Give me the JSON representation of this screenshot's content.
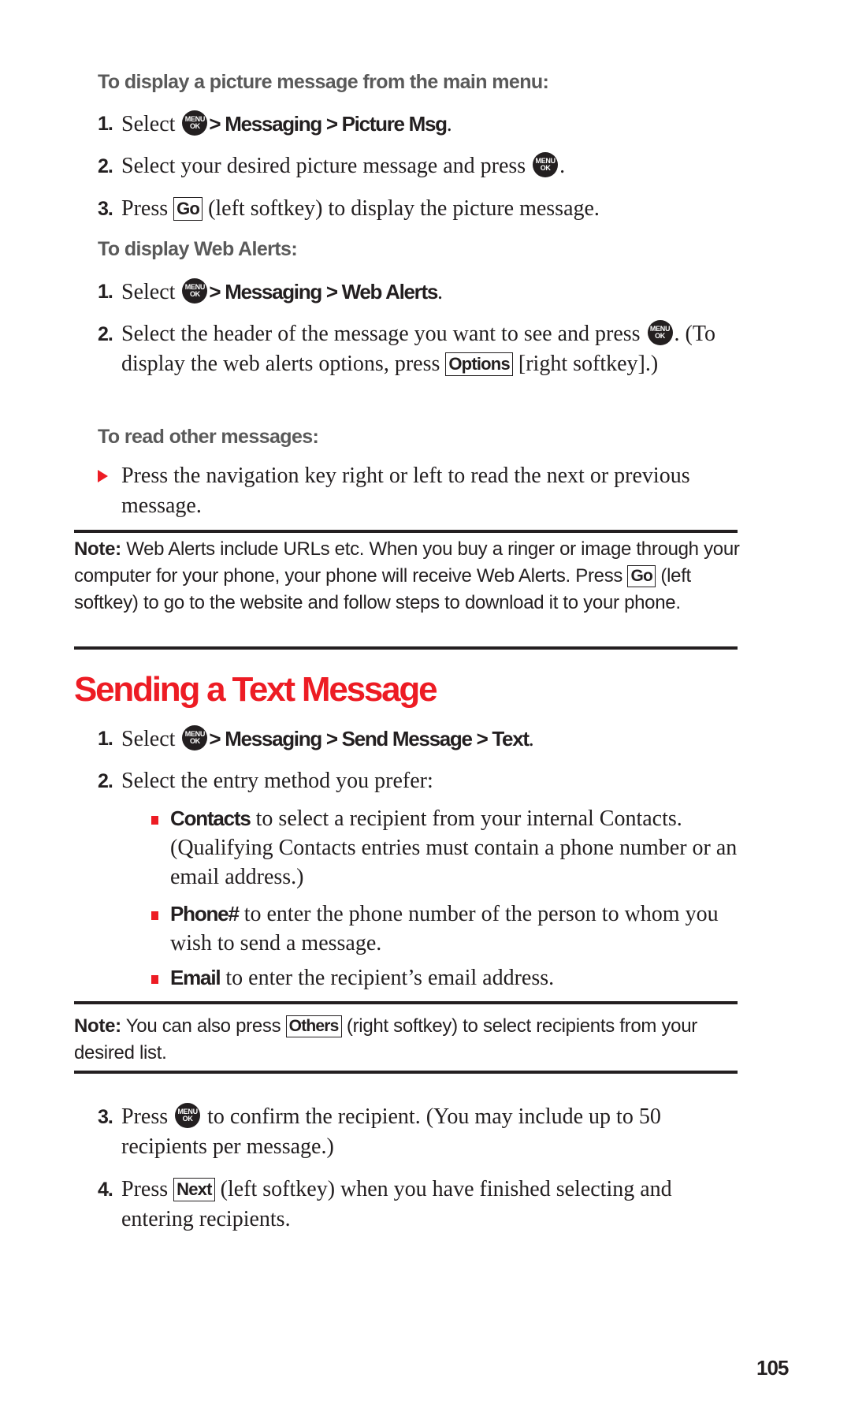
{
  "section1": {
    "subhead": "To display a picture message from the main menu:",
    "steps": [
      {
        "num": "1.",
        "pre": "Select",
        "path": "> Messaging > Picture Msg",
        "post": "."
      },
      {
        "num": "2.",
        "pre": "Select your desired picture message and press",
        "post": "."
      },
      {
        "num": "3.",
        "pre": "Press",
        "softkey": "Go",
        "post": "(left softkey) to display the picture message."
      }
    ]
  },
  "section2": {
    "subhead": "To display Web Alerts:",
    "steps": [
      {
        "num": "1.",
        "pre": "Select",
        "path": "> Messaging > Web Alerts",
        "post": "."
      },
      {
        "num": "2.",
        "pre": "Select the header of the message you want to see and press",
        "post": ".",
        "line2_pre": "(To display the web alerts options, press",
        "softkey": "Options",
        "line2_post": "[right softkey].)"
      }
    ]
  },
  "section3": {
    "subhead": "To read other messages:",
    "bullet": "Press the navigation key right or left to read the next or previous message."
  },
  "note1": {
    "label": "Note:",
    "text_pre": "Web Alerts include URLs etc. When you buy a ringer or image through your computer for your phone, your phone will receive Web Alerts. Press",
    "softkey": "Go",
    "text_post": "(left softkey) to go to the website and follow steps to download it to your phone."
  },
  "heading": "Sending a Text Message",
  "section4": {
    "steps": [
      {
        "num": "1.",
        "pre": "Select",
        "path": "> Messaging > Send Message > Text",
        "post": "."
      },
      {
        "num": "2.",
        "pre": "Select the entry method you prefer:"
      }
    ],
    "options": [
      {
        "label": "Contacts",
        "text": "to select a recipient from your internal Contacts. (Qualifying Contacts entries must contain a phone number or an email address.)"
      },
      {
        "label": "Phone#",
        "text": "to enter the phone number of the person to whom you wish to send a message."
      },
      {
        "label": "Email",
        "text": "to enter the recipient’s email address."
      }
    ]
  },
  "note2": {
    "label": "Note:",
    "text_pre": "You can also press",
    "softkey": "Others",
    "text_post": "(right softkey) to select recipients from your desired list."
  },
  "section5": {
    "steps": [
      {
        "num": "3.",
        "pre": "Press",
        "post": "to confirm the recipient. (You may include up to 50 recipients per message.)"
      },
      {
        "num": "4.",
        "pre": "Press",
        "softkey": "Next",
        "post": "(left softkey) when you have finished selecting and entering recipients."
      }
    ]
  },
  "menu_icon": {
    "line1": "MENU",
    "line2": "OK"
  },
  "page_number": "105",
  "colors": {
    "accent": "#ed1c24",
    "text": "#231f20",
    "subhead": "#5a5a5a"
  }
}
